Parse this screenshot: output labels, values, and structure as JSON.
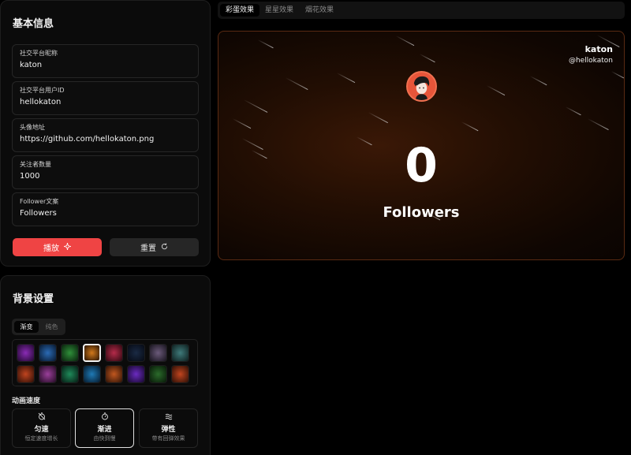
{
  "basic": {
    "title": "基本信息",
    "fields": [
      {
        "label": "社交平台昵称",
        "value": "katon"
      },
      {
        "label": "社交平台用户ID",
        "value": "hellokaton"
      },
      {
        "label": "头像地址",
        "value": "https://github.com/hellokaton.png"
      },
      {
        "label": "关注者数量",
        "value": "1000"
      },
      {
        "label": "Follower文案",
        "value": "Followers"
      }
    ],
    "play_label": "播放",
    "reset_label": "重置"
  },
  "effects": {
    "tabs": [
      "彩蛋效果",
      "星星效果",
      "烟花效果"
    ],
    "active_tab": 0
  },
  "preview": {
    "name": "katon",
    "handle": "@hellokaton",
    "count": "0",
    "follower_text": "Followers"
  },
  "background": {
    "title": "背景设置",
    "modes": [
      "渐变",
      "纯色"
    ],
    "active_mode": 0,
    "swatch_colors": [
      "#8a2bb5",
      "#2b6bb5",
      "#2f8f3a",
      "#d1781b",
      "#b52b4a",
      "#1a2a44",
      "#6b5a7a",
      "#3f7a7a",
      "#c1441f",
      "#9b3f9b",
      "#1f8a5a",
      "#1f7ab5",
      "#c1571f",
      "#6b2bc1",
      "#2b6b2b",
      "#c1451f"
    ],
    "selected_swatch": 3,
    "speed_label": "动画速度",
    "speeds": [
      {
        "icon": "timer-off-icon",
        "title": "匀速",
        "subtitle": "恒定速度增长"
      },
      {
        "icon": "timer-icon",
        "title": "渐进",
        "subtitle": "由快到慢"
      },
      {
        "icon": "waves-icon",
        "title": "弹性",
        "subtitle": "带有回弹效果"
      }
    ],
    "active_speed": 1
  }
}
